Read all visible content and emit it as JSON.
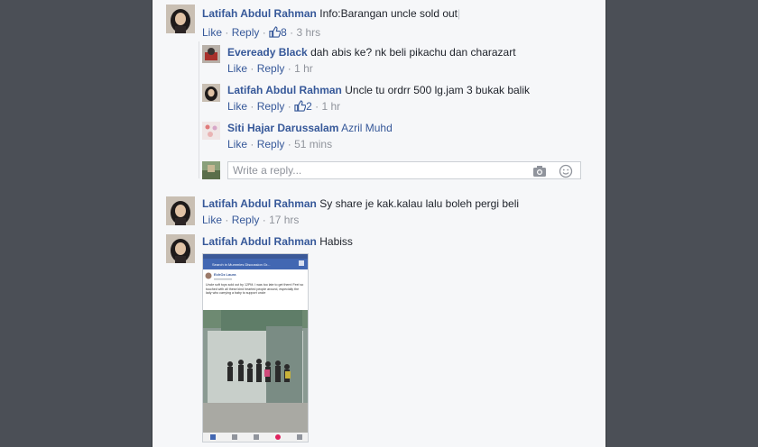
{
  "comments": [
    {
      "author": "Latifah Abdul Rahman",
      "text": "Info:Barangan uncle sold out",
      "like_label": "Like",
      "reply_label": "Reply",
      "likes": "8",
      "time": "3 hrs"
    },
    {
      "author": "Latifah Abdul Rahman",
      "text": "Sy share je kak.kalau lalu boleh pergi beli",
      "like_label": "Like",
      "reply_label": "Reply",
      "time": "17 hrs"
    },
    {
      "author": "Latifah Abdul Rahman",
      "text": "Habiss"
    }
  ],
  "replies": [
    {
      "author": "Eveready Black",
      "text": "dah abis ke? nk beli pikachu dan charazart",
      "like_label": "Like",
      "reply_label": "Reply",
      "time": "1 hr"
    },
    {
      "author": "Latifah Abdul Rahman",
      "text": "Uncle tu ordrr 500 lg.jam 3 bukak balik",
      "like_label": "Like",
      "reply_label": "Reply",
      "likes": "2",
      "time": "1 hr"
    },
    {
      "author": "Siti Hajar Darussalam",
      "text": "Azril Muhd",
      "like_label": "Like",
      "reply_label": "Reply",
      "time": "51 mins"
    }
  ],
  "reply_box": {
    "placeholder": "Write a reply...",
    "camera_icon": "camera-icon",
    "emoji_icon": "emoji-icon"
  },
  "shared_image": {
    "screen_title": "Search in Mummies Discussion Gr...",
    "post_author": "EchOz Laura",
    "post_text": "Uncle soft toys sold out by 12PM. I was too late to get them! Feel so touched with all these kind hearted people around, especially the lady who carrying a baby to support uncle"
  },
  "colors": {
    "link": "#365899",
    "meta": "#90949c",
    "background": "#f6f7f9",
    "outer": "#4b4f56"
  }
}
